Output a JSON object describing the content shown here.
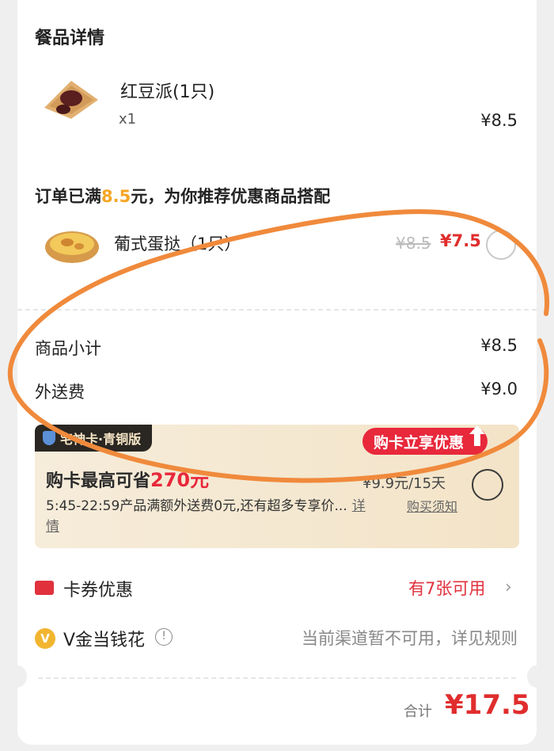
{
  "section": {
    "title": "餐品详情"
  },
  "item": {
    "name": "红豆派(1只)",
    "qty": "x1",
    "price": "¥8.5"
  },
  "recommend": {
    "title_prefix": "订单已满",
    "title_amount": "8.5",
    "title_suffix": "元，为你推荐优惠商品搭配",
    "name": "葡式蛋挞（1只）",
    "old_price": "¥8.5",
    "new_price": "¥7.5"
  },
  "summary": {
    "subtotal_label": "商品小计",
    "subtotal_value": "¥8.5",
    "delivery_label": "外送费",
    "delivery_value": "¥9.0"
  },
  "promo": {
    "tag": "宅神卡·青铜版",
    "badge": "购卡立享优惠",
    "headline_prefix": "购卡最高可省",
    "headline_amount": "270元",
    "price": "¥9.9元/15天",
    "desc": "5:45-22:59产品满额外送费0元,还有超多专享价...",
    "detail_link": "详情",
    "rules_link": "购买须知"
  },
  "coupon": {
    "label": "卡券优惠",
    "value": "有7张可用"
  },
  "vgold": {
    "icon_text": "V",
    "label": "V金当钱花",
    "note": "当前渠道暂不可用，详见规则"
  },
  "total": {
    "label": "合计",
    "value": "¥17.5"
  },
  "colors": {
    "accent_red": "#e02d2d",
    "highlight_orange": "#f5a623",
    "annotation_orange": "#f08a3c",
    "promo_bg": "#f5e8d2"
  },
  "icons": {
    "food": "red-bean-pie-icon",
    "tart": "egg-tart-icon",
    "coupon": "ticket-icon",
    "vgold": "v-coin-icon",
    "info": "info-icon",
    "chevron": "chevron-right-icon"
  }
}
